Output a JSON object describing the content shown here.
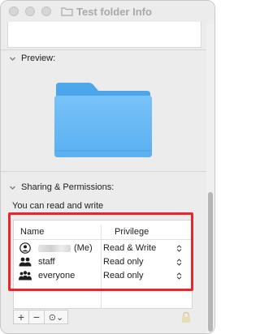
{
  "window": {
    "title": "Test folder Info"
  },
  "preview": {
    "header": "Preview:",
    "icon": "folder-icon",
    "folder_color": "#5ab4f5"
  },
  "sharing": {
    "header": "Sharing & Permissions:",
    "status": "You can read and write",
    "columns": {
      "name": "Name",
      "privilege": "Privilege"
    },
    "rows": [
      {
        "name": "(Me)",
        "privilege": "Read & Write",
        "icon": "single-user-icon"
      },
      {
        "name": "staff",
        "privilege": "Read only",
        "icon": "group-icon"
      },
      {
        "name": "everyone",
        "privilege": "Read only",
        "icon": "everyone-icon"
      }
    ],
    "highlight_color": "#e8272c"
  },
  "toolbar": {
    "add_label": "+",
    "remove_label": "−",
    "action_label": "⊙⌄"
  }
}
